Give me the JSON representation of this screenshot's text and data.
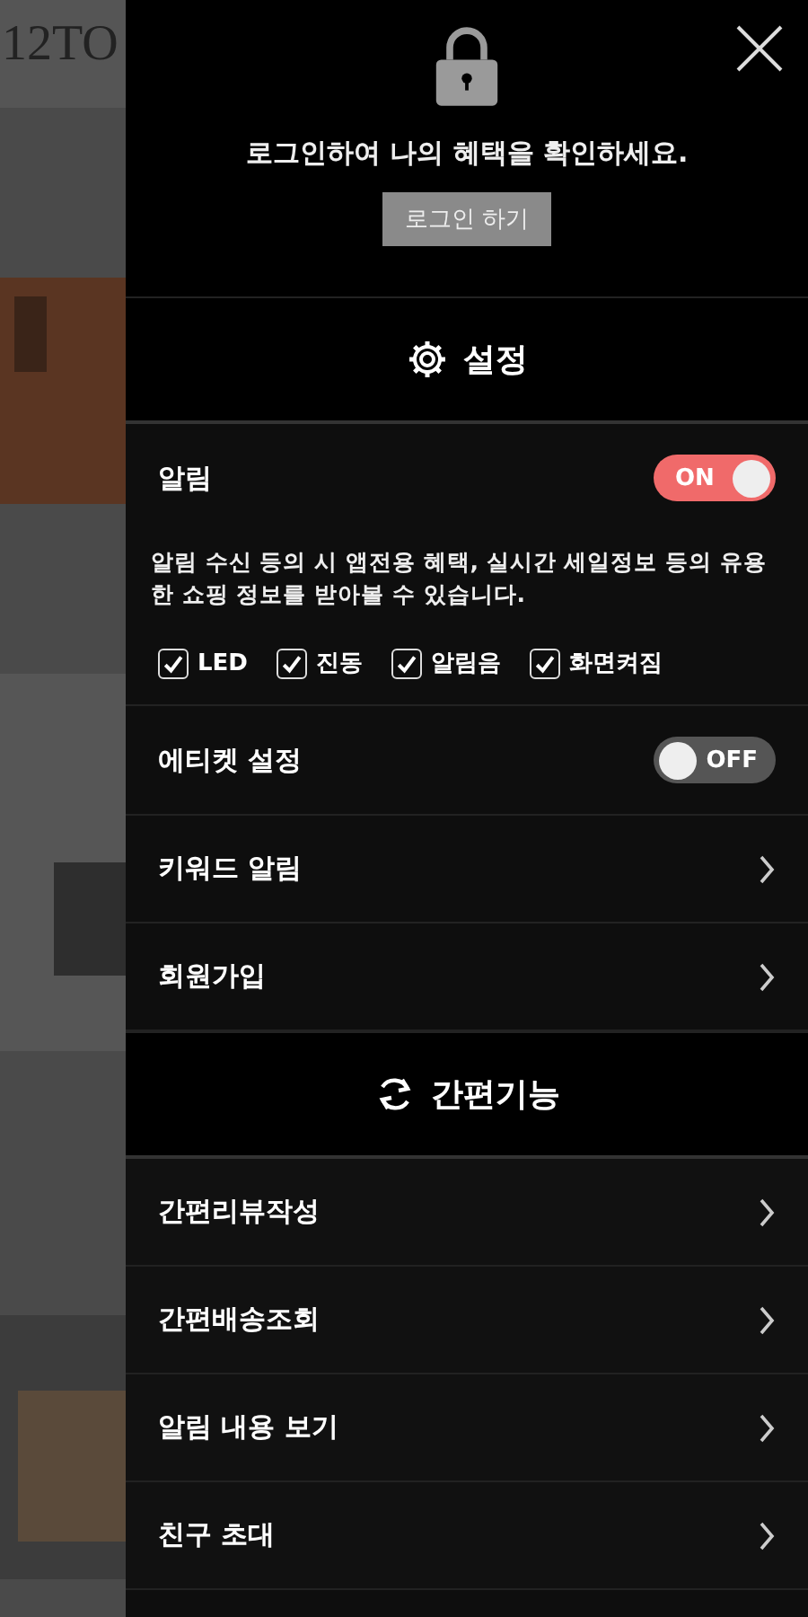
{
  "backdrop": {
    "logo": "12TO",
    "kind": "picture"
  },
  "login": {
    "message": "로그인하여 나의 혜택을 확인하세요.",
    "button": "로그인 하기"
  },
  "settings": {
    "title": "설정",
    "items": [
      {
        "kind": "toggle",
        "label": "알림",
        "on": true,
        "state_text": "ON",
        "description": "알림 수신 등의 시 앱전용 혜택, 실시간 세일정보 등의 유용한 쇼핑 정보를 받아볼 수 있습니다.",
        "checkboxes": [
          {
            "label": "LED",
            "checked": true
          },
          {
            "label": "진동",
            "checked": true
          },
          {
            "label": "알림음",
            "checked": true
          },
          {
            "label": "화면켜짐",
            "checked": true
          }
        ]
      },
      {
        "kind": "toggle",
        "label": "에티켓 설정",
        "on": false,
        "state_text": "OFF"
      },
      {
        "kind": "link",
        "label": "키워드 알림"
      },
      {
        "kind": "link",
        "label": "회원가입"
      }
    ]
  },
  "quick": {
    "title": "간편기능",
    "items": [
      {
        "kind": "link",
        "label": "간편리뷰작성"
      },
      {
        "kind": "link",
        "label": "간편배송조회"
      },
      {
        "kind": "link",
        "label": "알림 내용 보기"
      },
      {
        "kind": "link",
        "label": "친구 초대"
      }
    ]
  }
}
